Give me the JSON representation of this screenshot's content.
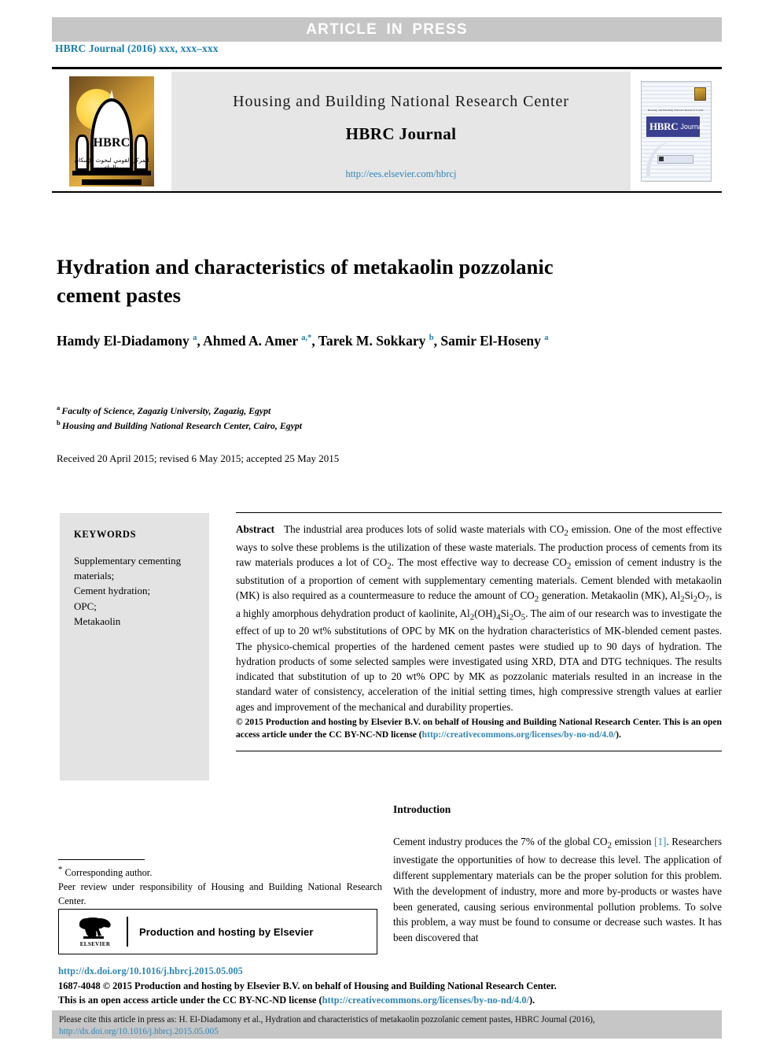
{
  "banner": {
    "text": "ARTICLE  IN  PRESS"
  },
  "running_head": "HBRC Journal (2016) xxx, xxx–xxx",
  "masthead": {
    "center_title": "Housing and Building National Research Center",
    "journal_name": "HBRC Journal",
    "url": "http://ees.elsevier.com/hbrcj",
    "logo_text": "HBRC",
    "logo_arabic": "المركز القومي لبحوث الإسكان والبناء",
    "cover_title": "HBRC",
    "cover_subtitle": "Journal",
    "cover_band_sub": "Housing and Building National Research Center"
  },
  "article": {
    "title": "Hydration and characteristics of metakaolin pozzolanic cement pastes",
    "authors": [
      {
        "name": "Hamdy El-Diadamony",
        "marks": "a",
        "sep": ", "
      },
      {
        "name": "Ahmed A. Amer",
        "marks": "a,*",
        "sep": ", "
      },
      {
        "name": "Tarek M. Sokkary",
        "marks": "b",
        "sep": ", "
      },
      {
        "name": "Samir El-Hoseny",
        "marks": "a",
        "sep": ""
      }
    ],
    "affiliations": [
      {
        "mark": "a",
        "text": "Faculty of Science, Zagazig University, Zagazig, Egypt"
      },
      {
        "mark": "b",
        "text": "Housing and Building National Research Center, Cairo, Egypt"
      }
    ],
    "received": "Received 20 April 2015; revised 6 May 2015; accepted 25 May 2015"
  },
  "keywords": {
    "heading": "KEYWORDS",
    "items": [
      "Supplementary cementing materials;",
      "Cement hydration;",
      "OPC;",
      "Metakaolin"
    ]
  },
  "abstract": {
    "label": "Abstract",
    "text": "The industrial area produces lots of solid waste materials with CO2 emission. One of the most effective ways to solve these problems is the utilization of these waste materials. The production process of cements from its raw materials produces a lot of CO2. The most effective way to decrease CO2 emission of cement industry is the substitution of a proportion of cement with supplementary cementing materials. Cement blended with metakaolin (MK) is also required as a countermeasure to reduce the amount of CO2 generation. Metakaolin (MK), Al2Si2O7, is a highly amorphous dehydration product of kaolinite, Al2(OH)4Si2O5. The aim of our research was to investigate the effect of up to 20 wt% substitutions of OPC by MK on the hydration characteristics of MK-blended cement pastes. The physico-chemical properties of the hardened cement pastes were studied up to 90 days of hydration. The hydration products of some selected samples were investigated using XRD, DTA and DTG techniques. The results indicated that substitution of up to 20 wt% OPC by MK as pozzolanic materials resulted in an increase in the standard water of consistency, acceleration of the initial setting times, high compressive strength values at earlier ages and improvement of the mechanical and durability properties.",
    "copyright": "© 2015 Production and hosting by Elsevier B.V. on behalf of Housing and Building National Research Center. This is an open access article under the CC BY-NC-ND license (",
    "license_url": "http://creativecommons.org/licenses/by-no-nd/4.0/",
    "copyright_tail": ")."
  },
  "introduction": {
    "heading": "Introduction",
    "paragraph_pre": "Cement industry produces the 7% of the global CO2 emission ",
    "reference": "[1]",
    "paragraph_post": ". Researchers investigate the opportunities of how to decrease this level. The application of different supplementary materials can be the proper solution for this problem. With the development of industry, more and more by-products or wastes have been generated, causing serious environmental pollution problems. To solve this problem, a way must be found to consume or decrease such wastes. It has been discovered that"
  },
  "footnotes": {
    "corresponding": "Corresponding author.",
    "peer_review": "Peer review under responsibility of Housing and Building National Research Center.",
    "elsevier_box": "Production and hosting by Elsevier",
    "elsevier_wordmark": "ELSEVIER"
  },
  "footer": {
    "doi": "http://dx.doi.org/10.1016/j.hbrcj.2015.05.005",
    "copyright_line1": "1687-4048 © 2015 Production and hosting by Elsevier B.V. on behalf of Housing and Building National Research Center.",
    "copyright_line2_pre": "This is an open access article under the CC BY-NC-ND license (",
    "copyright_license_url": "http://creativecommons.org/licenses/by-no-nd/4.0/",
    "copyright_line2_post": ")."
  },
  "citation": {
    "text_pre": "Please cite this article in press as: H. El-Diadamony et al., Hydration and characteristics of metakaolin pozzolanic cement pastes,  HBRC Journal (2016), ",
    "link": "http://dx.doi.org/10.1016/j.hbrcj.2015.05.005"
  },
  "colors": {
    "link": "#2f86b8",
    "banner_bg": "#c6c6c6",
    "keywords_bg": "#e3e3e3",
    "masthead_bg": "#e6e6e6"
  }
}
